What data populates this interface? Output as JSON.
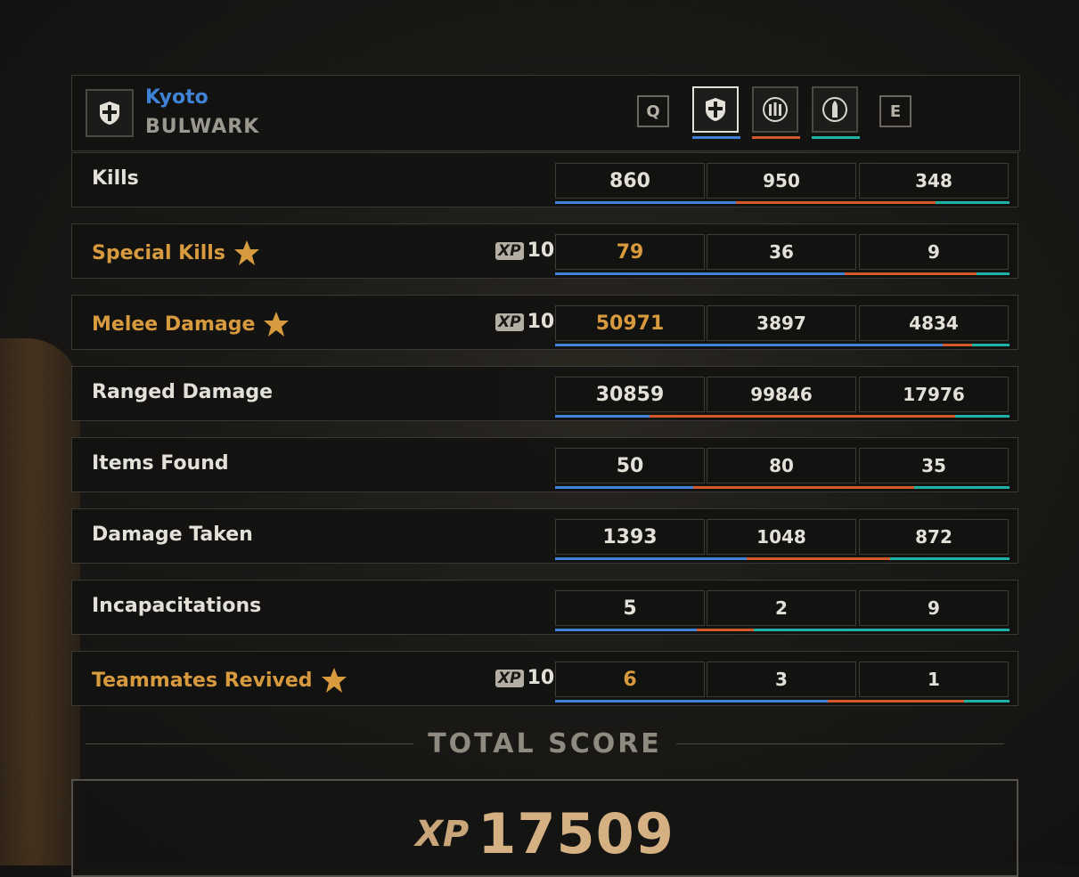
{
  "player": {
    "name": "Kyoto",
    "class": "BULWARK"
  },
  "tabs": {
    "prev_key": "Q",
    "next_key": "E",
    "items": [
      {
        "icon": "shield-class-icon",
        "color": "#3e83d6",
        "active": true
      },
      {
        "icon": "ammo-class-icon",
        "color": "#d2582c",
        "active": false
      },
      {
        "icon": "bullet-class-icon",
        "color": "#1fb3a6",
        "active": false
      }
    ]
  },
  "player_colors": [
    "#3e83d6",
    "#d2582c",
    "#1fb3a6"
  ],
  "stats": [
    {
      "label": "Kills",
      "special": false,
      "xp": "",
      "values": [
        "860",
        "950",
        "348"
      ]
    },
    {
      "label": "Special Kills",
      "special": true,
      "xp": "10",
      "values": [
        "79",
        "36",
        "9"
      ]
    },
    {
      "label": "Melee Damage",
      "special": true,
      "xp": "10",
      "values": [
        "50971",
        "3897",
        "4834"
      ]
    },
    {
      "label": "Ranged Damage",
      "special": false,
      "xp": "",
      "values": [
        "30859",
        "99846",
        "17976"
      ]
    },
    {
      "label": "Items Found",
      "special": false,
      "xp": "",
      "values": [
        "50",
        "80",
        "35"
      ]
    },
    {
      "label": "Damage Taken",
      "special": false,
      "xp": "",
      "values": [
        "1393",
        "1048",
        "872"
      ]
    },
    {
      "label": "Incapacitations",
      "special": false,
      "xp": "",
      "values": [
        "5",
        "2",
        "9"
      ]
    },
    {
      "label": "Teammates Revived",
      "special": true,
      "xp": "10",
      "values": [
        "6",
        "3",
        "1"
      ]
    }
  ],
  "total": {
    "title": "TOTAL SCORE",
    "xp_label": "XP",
    "value": "17509"
  },
  "xp_badge": "XP"
}
